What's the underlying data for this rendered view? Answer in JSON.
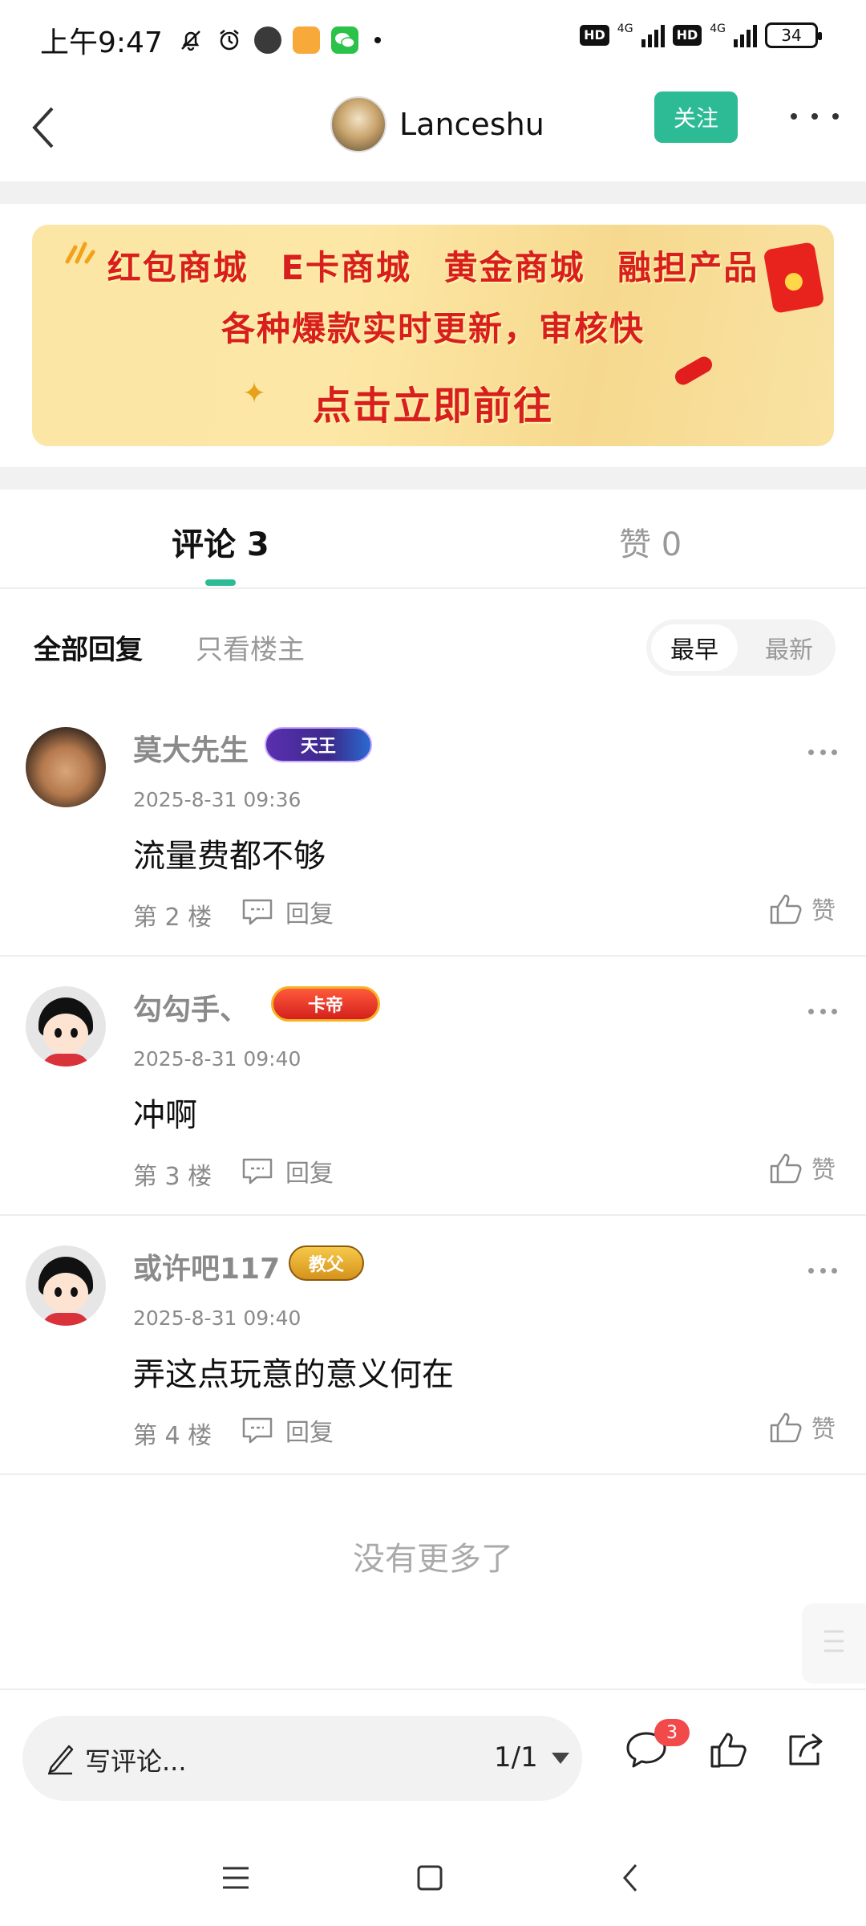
{
  "status_bar": {
    "time": "上午9:47",
    "network_1": "4G",
    "network_2": "4G",
    "hd_1": "HD",
    "hd_2": "HD",
    "battery": "34"
  },
  "header": {
    "username": "Lanceshu",
    "follow_label": "关注"
  },
  "banner": {
    "line1": "红包商城 E卡商城 黄金商城 融担产品",
    "line2": "各种爆款实时更新，审核快",
    "line3": "点击立即前往"
  },
  "tabs": {
    "comments_label": "评论 3",
    "likes_label": "赞 0"
  },
  "filters": {
    "all_label": "全部回复",
    "owner_only_label": "只看楼主",
    "sort_earliest": "最早",
    "sort_newest": "最新"
  },
  "comments": [
    {
      "name": "莫大先生",
      "badge": "天王",
      "time": "2025-8-31 09:36",
      "text": "流量费都不够",
      "floor": "第 2 楼",
      "reply_label": "回复",
      "like_label": "赞"
    },
    {
      "name": "勾勾手、",
      "badge": "卡帝",
      "time": "2025-8-31 09:40",
      "text": "冲啊",
      "floor": "第 3 楼",
      "reply_label": "回复",
      "like_label": "赞"
    },
    {
      "name": "或许吧117",
      "badge": "教父",
      "time": "2025-8-31 09:40",
      "text": "弄这点玩意的意义何在",
      "floor": "第 4 楼",
      "reply_label": "回复",
      "like_label": "赞"
    }
  ],
  "footer": {
    "no_more": "没有更多了"
  },
  "bottom_bar": {
    "input_placeholder": "写评论...",
    "page_indicator": "1/1",
    "comment_count": "3"
  },
  "colors": {
    "accent": "#2dbb95",
    "badge_red": "#f24a4a",
    "banner_text": "#d81e1e"
  }
}
